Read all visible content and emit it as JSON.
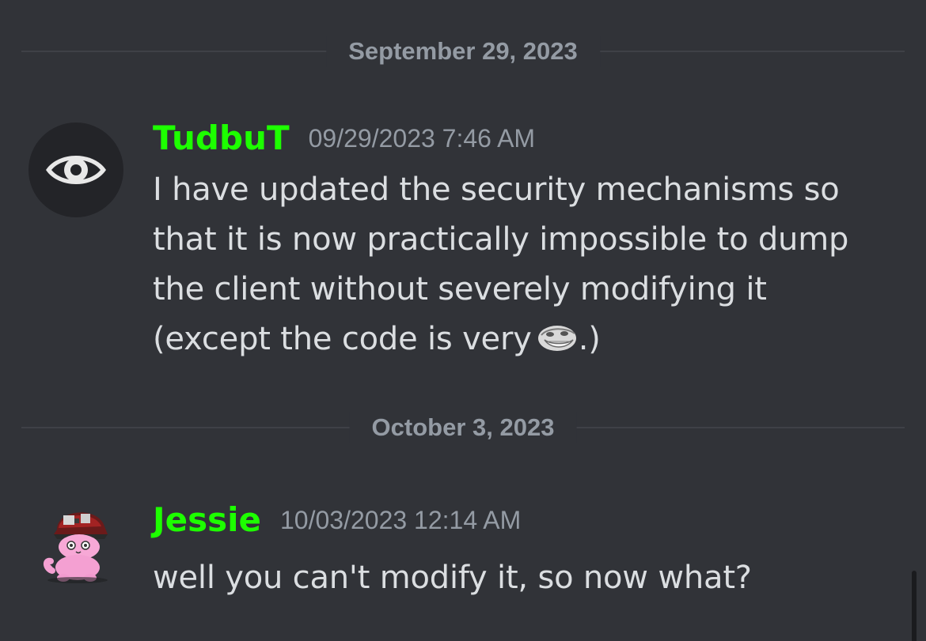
{
  "dividers": [
    {
      "label": "September 29, 2023"
    },
    {
      "label": "October 3, 2023"
    }
  ],
  "messages": [
    {
      "username": "TudbuT",
      "timestamp": "09/29/2023 7:46 AM",
      "avatar_icon": "eye-icon",
      "lines": [
        "I have updated the security mechanisms so",
        "that it is now practically impossible to dump",
        "the client without severely modifying it",
        "(except the code is very"
      ],
      "trailing_text": ".)",
      "emoji": "trollface-emoji"
    },
    {
      "username": "Jessie",
      "timestamp": "10/03/2023 12:14 AM",
      "avatar_icon": "pink-cat-helmet-avatar",
      "lines": [
        "well you can't modify it, so now what?"
      ]
    }
  ],
  "colors": {
    "background": "#313338",
    "username": "#1dff00",
    "timestamp": "#949ba4",
    "text": "#dbdee1",
    "divider": "#3f4147"
  }
}
